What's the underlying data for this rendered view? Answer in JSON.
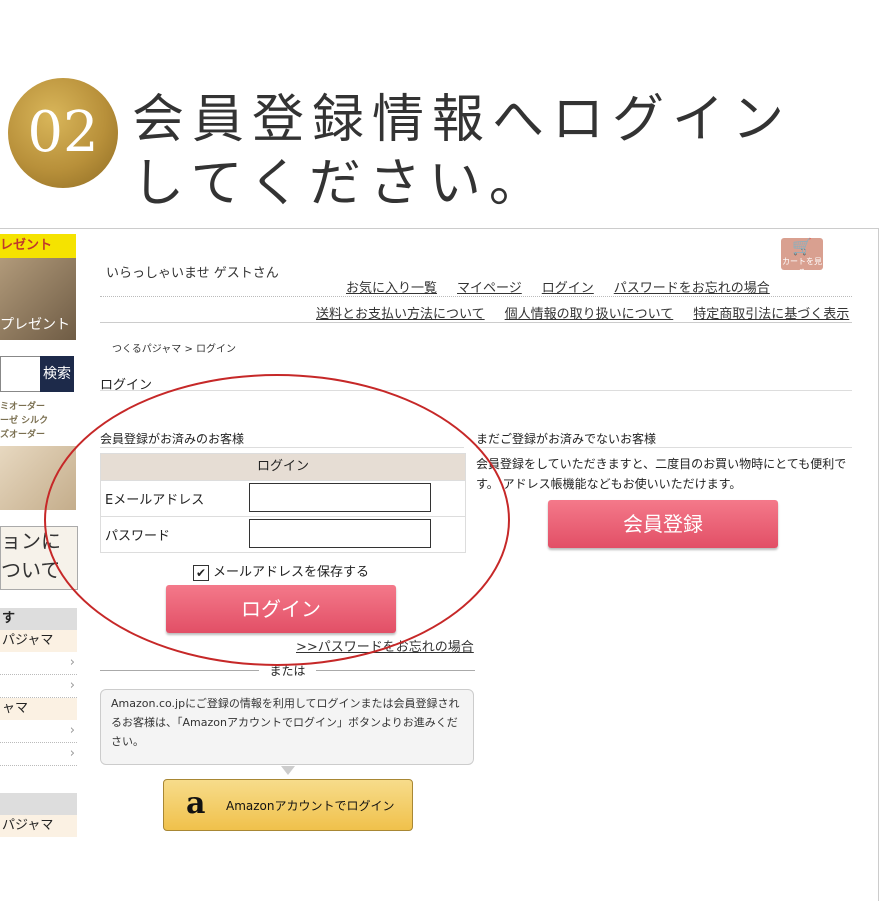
{
  "step": {
    "number": "02",
    "headline": "会員登録情報へログイン\nしてください。"
  },
  "sidebar": {
    "present_top": "レゼント",
    "present_img_label": "プレゼント",
    "search_button": "検索",
    "small_text": "ミオーダー\nーゼ シルク\nズオーダー",
    "banner_text": "ョンに\nついて",
    "list1_head": "す",
    "list1_rows": [
      "パジャマ",
      "",
      "",
      "ャマ",
      "",
      ""
    ],
    "list2_rows": [
      "パジャマ"
    ],
    "chevron": "›"
  },
  "header": {
    "cart_label": "カートを見る",
    "welcome": "いらっしゃいませ  ゲストさん",
    "nav1": [
      "お気に入り一覧",
      "マイページ",
      "ログイン",
      "パスワードをお忘れの場合"
    ],
    "nav2": [
      "送料とお支払い方法について",
      "個人情報の取り扱いについて",
      "特定商取引法に基づく表示"
    ]
  },
  "breadcrumb": "つくるパジャマ > ログイン",
  "page_title": "ログイン",
  "member": {
    "section_label": "会員登録がお済みのお客様",
    "table_head": "ログイン",
    "email_label": "Eメールアドレス",
    "password_label": "パスワード",
    "email_value": "",
    "password_value": "",
    "save_email_label": "メールアドレスを保存する",
    "save_email_checked": true,
    "login_button": "ログイン",
    "forgot_link": ">>パスワードをお忘れの場合",
    "or_text": "または",
    "amazon_info": "Amazon.co.jpにご登録の情報を利用してログインまたは会員登録されるお客様は、「Amazonアカウントでログイン」ボタンよりお進みください。",
    "amazon_button": "Amazonアカウントでログイン"
  },
  "guest": {
    "section_label": "まだご登録がお済みでないお客様",
    "description": "会員登録をしていただきますと、二度目のお買い物時にとても便利です。 アドレス帳機能などもお使いいただけます。",
    "register_button": "会員登録"
  },
  "colors": {
    "accent_pink": "#e24f66",
    "highlight_red": "#c62828",
    "badge_gold": "#b8903a",
    "amazon_yellow": "#f0c14b"
  }
}
